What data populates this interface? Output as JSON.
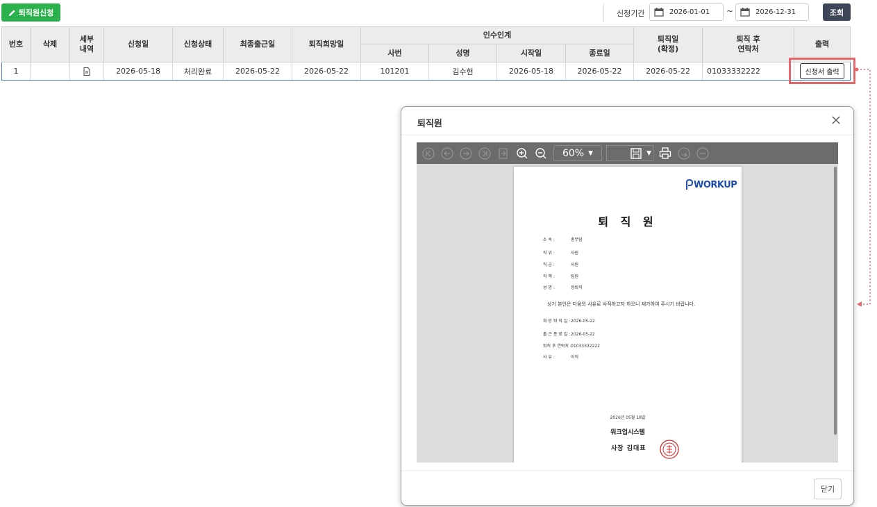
{
  "toolbar": {
    "apply_button": "퇴직원신청",
    "period_label": "신청기간",
    "start_date": "2026-01-01",
    "dash": "~",
    "end_date": "2026-12-31",
    "search_button": "조회"
  },
  "table": {
    "headers": {
      "no": "번호",
      "delete": "삭제",
      "detail_1": "세부",
      "detail_2": "내역",
      "apply_date": "신청일",
      "status": "신청상태",
      "last_work": "최종출근일",
      "wish_date": "퇴직희망일",
      "handover": "인수인계",
      "emp_no": "사번",
      "name": "성명",
      "start": "시작일",
      "end": "종료일",
      "retire_1": "퇴직일",
      "retire_2": "(확정)",
      "contact_1": "퇴직 후",
      "contact_2": "연락처",
      "print": "출력"
    },
    "row": {
      "no": "1",
      "apply_date": "2026-05-18",
      "status": "처리완료",
      "last_work": "2026-05-22",
      "wish_date": "2026-05-22",
      "emp_no": "101201",
      "name": "김수현",
      "start": "2026-05-18",
      "end": "2026-05-22",
      "retire": "2026-05-22",
      "contact": "01033332222",
      "print_button": "신청서 출력"
    }
  },
  "modal": {
    "title": "퇴직원",
    "close_button": "닫기",
    "viewer": {
      "zoom": "60%"
    },
    "document": {
      "logo": "WORKUP",
      "title": "퇴 직 원",
      "fields": [
        {
          "k": "소          속 :",
          "v": "총무팀"
        },
        {
          "k": "직          위 :",
          "v": "사원"
        },
        {
          "k": "직          급 :",
          "v": "사원"
        },
        {
          "k": "직          책 :",
          "v": "팀원"
        },
        {
          "k": "성          명 :",
          "v": "정퇴직"
        }
      ],
      "statement": "상기 본인은 다음의 사유로 사직하고자 하오니 재가하여 주시기 바랍니다.",
      "details": [
        {
          "k": "희 망 퇴 직 일 :",
          "v": "2026-05-22"
        },
        {
          "k": "출 근 종 료 일 :",
          "v": "2026-05-22"
        },
        {
          "k": "퇴직 후 연락처 :",
          "v": "01033332222"
        },
        {
          "k": "사          유 :",
          "v": "이직"
        }
      ],
      "sign_date": "2026년 05월 18일",
      "company": "워크업시스템",
      "ceo": "사장  김대표"
    }
  },
  "colors": {
    "green": "#2bb24c",
    "navy": "#3d4658",
    "highlight": "#e5676b",
    "row_border": "#4a7fd1"
  }
}
